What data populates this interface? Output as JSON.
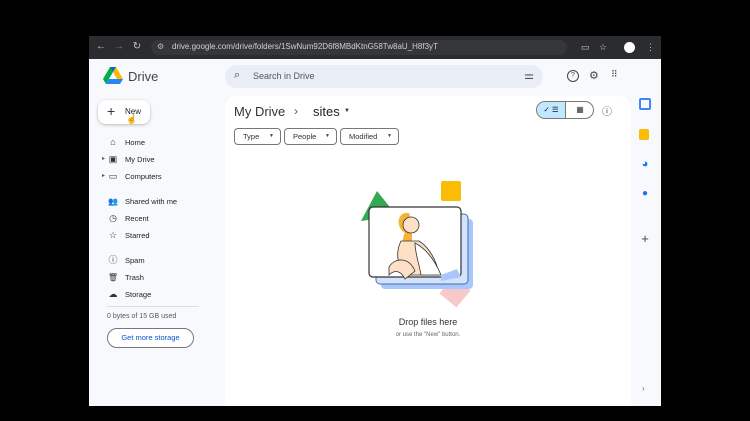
{
  "browser": {
    "url": "drive.google.com/drive/folders/1SwNum92D6f8MBdKtnG58Tw8aU_H8f3yT",
    "nav": {
      "back": "←",
      "forward": "→",
      "reload": "↻"
    },
    "right_icons": {
      "cast": "cast-icon",
      "bookmark": "☆",
      "menu": "⋮"
    }
  },
  "header": {
    "brand": "Drive",
    "search_placeholder": "Search in Drive",
    "icons": {
      "search": "🔍",
      "filter": "☰",
      "help": "?",
      "settings": "⚙",
      "apps": "⋮⋮⋮"
    }
  },
  "sidebar": {
    "new_label": "New",
    "items": [
      {
        "label": "Home",
        "icon": "home-icon",
        "glyph": "⌂"
      },
      {
        "label": "My Drive",
        "icon": "my-drive-icon",
        "glyph": "▣"
      },
      {
        "label": "Computers",
        "icon": "computers-icon",
        "glyph": "▭"
      },
      {
        "label": "Shared with me",
        "icon": "shared-icon",
        "glyph": "👥"
      },
      {
        "label": "Recent",
        "icon": "recent-icon",
        "glyph": "◷"
      },
      {
        "label": "Starred",
        "icon": "star-icon",
        "glyph": "☆"
      },
      {
        "label": "Spam",
        "icon": "spam-icon",
        "glyph": "ⓘ"
      },
      {
        "label": "Trash",
        "icon": "trash-icon",
        "glyph": "🗑"
      },
      {
        "label": "Storage",
        "icon": "cloud-icon",
        "glyph": "☁"
      }
    ],
    "storage_text": "0 bytes of 15 GB used",
    "get_more_label": "Get more storage"
  },
  "main": {
    "breadcrumb_root": "My Drive",
    "breadcrumb_sep": "›",
    "breadcrumb_current": "sites",
    "view_list": "✓ ☰",
    "view_grid": "▦",
    "info": "ⓘ",
    "filters": [
      "Type",
      "People",
      "Modified"
    ],
    "empty_title": "Drop files here",
    "empty_subtitle": "or use the \"New\" button."
  },
  "rail": {
    "icons": [
      "calendar-icon",
      "keep-icon",
      "tasks-icon",
      "contacts-icon",
      "add-icon"
    ],
    "add": "+",
    "expand": "›"
  },
  "colors": {
    "chrome_bar": "#2b2c30",
    "app_bg": "#f7f9fc",
    "accent_blue": "#0b57d0",
    "toggle_active": "#c2e7ff"
  }
}
